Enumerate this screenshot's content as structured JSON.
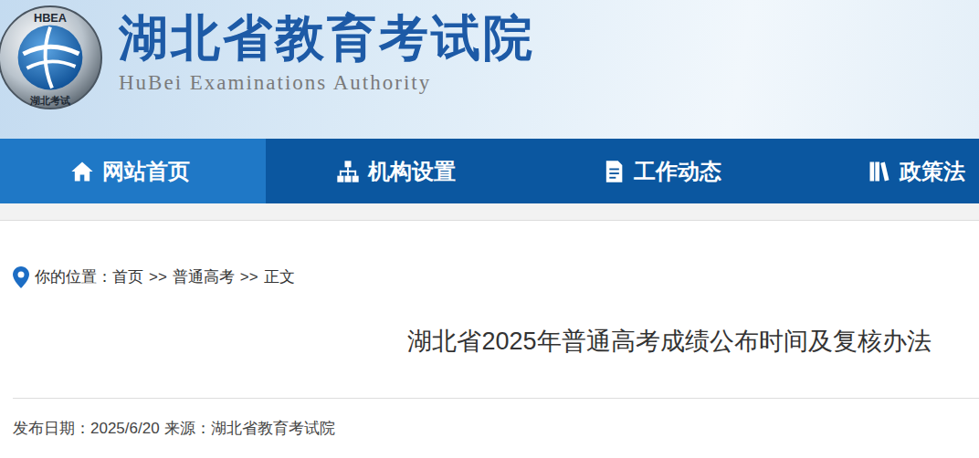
{
  "site": {
    "title": "湖北省教育考试院",
    "subtitle": "HuBei Examinations Authority",
    "logo": {
      "top": "HBEA",
      "bottom": "湖北考试"
    }
  },
  "nav": [
    {
      "label": "网站首页",
      "selected": true,
      "kind": "home"
    },
    {
      "label": "机构设置",
      "selected": false,
      "kind": "org"
    },
    {
      "label": "工作动态",
      "selected": false,
      "kind": "news"
    },
    {
      "label": "政策法",
      "selected": false,
      "kind": "policy"
    }
  ],
  "breadcrumb": {
    "prefix": "你的位置：",
    "items": [
      "首页",
      "普通高考",
      "正文"
    ],
    "separator": ">>"
  },
  "article": {
    "title": "湖北省2025年普通高考成绩公布时间及复核办法",
    "date_label": "发布日期：",
    "date": "2025/6/20",
    "source_label": "来源：",
    "source": "湖北省教育考试院"
  }
}
